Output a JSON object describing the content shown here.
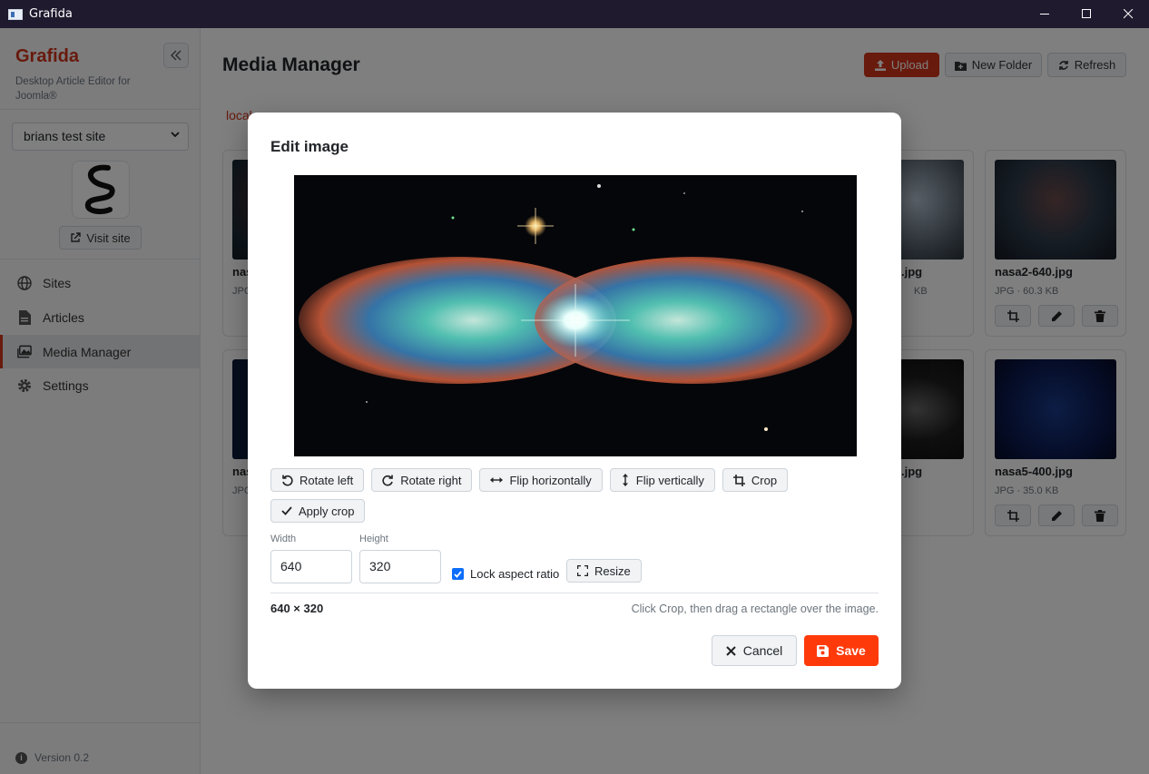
{
  "window": {
    "title": "Grafida"
  },
  "sidebar": {
    "brand_name": "Grafida",
    "brand_sub": "Desktop Article Editor for Joomla®",
    "site_select_value": "brians test site",
    "visit_label": "Visit site",
    "nav": [
      {
        "label": "Sites",
        "icon": "globe-icon"
      },
      {
        "label": "Articles",
        "icon": "document-icon"
      },
      {
        "label": "Media Manager",
        "icon": "images-icon",
        "active": true
      },
      {
        "label": "Settings",
        "icon": "gear-icon"
      }
    ],
    "version": "Version 0.2"
  },
  "main": {
    "title": "Media Manager",
    "upload_label": "Upload",
    "new_folder_label": "New Folder",
    "refresh_label": "Refresh",
    "breadcrumb": "local...",
    "cards": [
      {
        "name": "nas",
        "meta": "JPG"
      },
      {
        "name": ".jpg",
        "meta": "KB"
      },
      {
        "name": "nasa2-640.jpg",
        "meta": "JPG · 60.3 KB"
      },
      {
        "name": "nas",
        "meta": "JPG"
      },
      {
        "name": ".jpg",
        "meta": ""
      },
      {
        "name": "nasa5-400.jpg",
        "meta": "JPG · 35.0 KB"
      }
    ]
  },
  "modal": {
    "title": "Edit image",
    "tools": {
      "rotate_left": "Rotate left",
      "rotate_right": "Rotate right",
      "flip_h": "Flip horizontally",
      "flip_v": "Flip vertically",
      "crop": "Crop",
      "apply_crop": "Apply crop"
    },
    "width_label": "Width",
    "width_value": "640",
    "height_label": "Height",
    "height_value": "320",
    "lock_label": "Lock aspect ratio",
    "lock_checked": true,
    "resize_label": "Resize",
    "dims": "640 × 320",
    "hint": "Click Crop, then drag a rectangle over the image.",
    "cancel_label": "Cancel",
    "save_label": "Save"
  },
  "colors": {
    "accent": "#d0341a",
    "save": "#ff3a0a",
    "checkbox": "#0d6efd"
  }
}
